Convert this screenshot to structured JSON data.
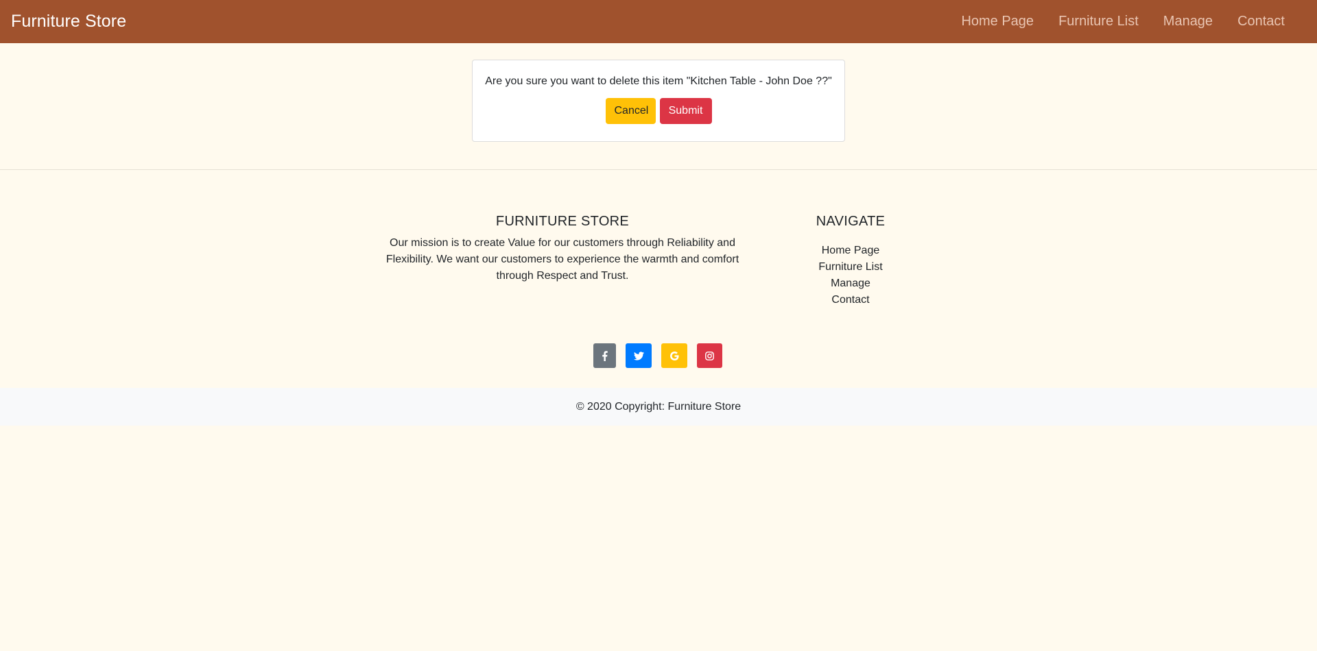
{
  "navbar": {
    "brand": "Furniture Store",
    "links": [
      "Home Page",
      "Furniture List",
      "Manage",
      "Contact"
    ],
    "background_color": "#a0522d"
  },
  "confirm": {
    "message": "Are you sure you want to delete this item \"Kitchen Table - John Doe ??\"",
    "cancel_label": "Cancel",
    "submit_label": "Submit"
  },
  "footer": {
    "about": {
      "heading": "FURNITURE STORE",
      "text": "Our mission is to create Value for our customers through Reliability and Flexibility. We want our customers to experience the warmth and comfort through Respect and Trust."
    },
    "navigate": {
      "heading": "NAVIGATE",
      "links": [
        "Home Page",
        "Furniture List",
        "Manage",
        "Contact"
      ]
    },
    "social": [
      {
        "icon": "facebook-icon",
        "color": "#6c757d"
      },
      {
        "icon": "twitter-icon",
        "color": "#007bff"
      },
      {
        "icon": "google-icon",
        "color": "#ffc107"
      },
      {
        "icon": "instagram-icon",
        "color": "#dc3545"
      }
    ],
    "copyright": "© 2020 Copyright: Furniture Store"
  }
}
